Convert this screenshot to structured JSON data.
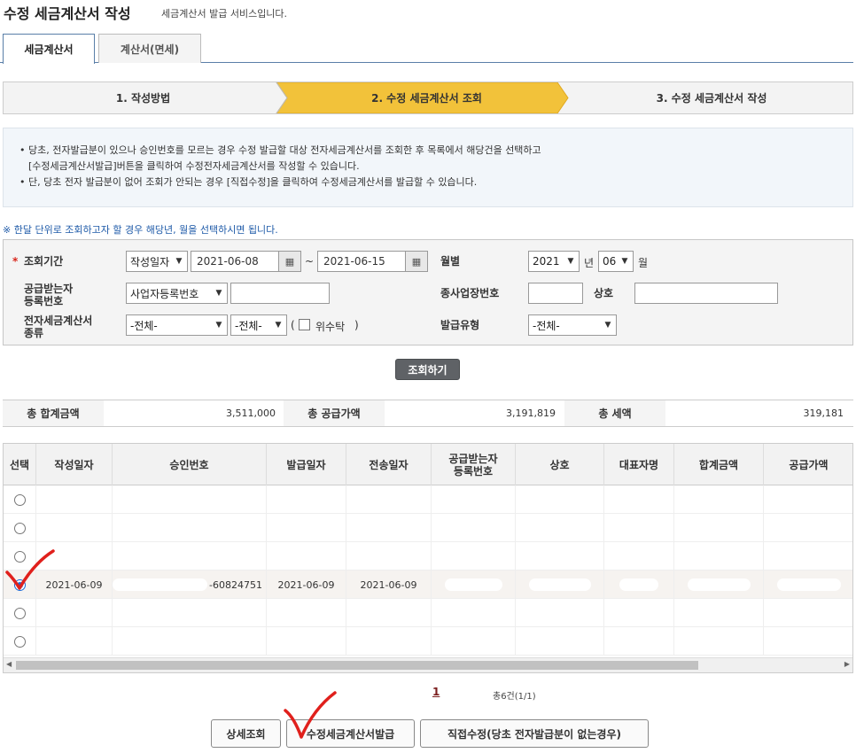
{
  "page": {
    "title": "수정 세금계산서 작성",
    "subtitle": "세금계산서 발급 서비스입니다."
  },
  "tabs": [
    {
      "label": "세금계산서",
      "active": true
    },
    {
      "label": "계산서(면세)",
      "active": false
    }
  ],
  "steps": [
    {
      "label": "1. 작성방법",
      "active": false
    },
    {
      "label": "2. 수정 세금계산서 조회",
      "active": true
    },
    {
      "label": "3. 수정 세금계산서 작성",
      "active": false
    }
  ],
  "notice": [
    "• 당초, 전자발급분이 있으나 승인번호를 모르는 경우 수정 발급할 대상 전자세금계산서를 조회한 후 목록에서 해당건을 선택하고",
    "  [수정세금계산서발급]버튼을 클릭하여 수정전자세금계산서를 작성할 수 있습니다.",
    "• 단, 당초 전자 발급분이 없어 조회가 안되는 경우 [직접수정]을 클릭하여 수정세금계산서를 발급할 수 있습니다."
  ],
  "hint": "※ 한달 단위로 조회하고자 할 경우 해당년, 월을 선택하시면 됩니다.",
  "search": {
    "period_required": "*",
    "period_label": "조회기간",
    "period_type": "작성일자",
    "date_from": "2021-06-08",
    "tilde": "~",
    "date_to": "2021-06-15",
    "monthly_label": "월별",
    "year": "2021",
    "year_unit": "년",
    "month": "06",
    "month_unit": "월",
    "recipient_label_1": "공급받는자",
    "recipient_label_2": "등록번호",
    "recipient_type": "사업자등록번호",
    "recipient_value": "",
    "branch_label": "종사업장번호",
    "branch_value": "",
    "company_label": "상호",
    "company_value": "",
    "kind_label_1": "전자세금계산서",
    "kind_label_2": "종류",
    "kind_1": "-전체-",
    "kind_2": "-전체-",
    "paren_open": "(",
    "trust_label": "위수탁",
    "paren_close": ")",
    "issue_type_label": "발급유형",
    "issue_type": "-전체-",
    "search_button": "조회하기"
  },
  "summary": {
    "total_label": "총 합계금액",
    "total_value": "3,511,000",
    "supply_label": "총 공급가액",
    "supply_value": "3,191,819",
    "tax_label": "총 세액",
    "tax_value": "319,181"
  },
  "table": {
    "headers": [
      "선택",
      "작성일자",
      "승인번호",
      "발급일자",
      "전송일자",
      "공급받는자\n등록번호",
      "상호",
      "대표자명",
      "합계금액",
      "공급가액"
    ],
    "header_recipient_1": "공급받는자",
    "header_recipient_2": "등록번호",
    "rows": [
      {
        "selected": false,
        "date": "",
        "approval": "",
        "issue": "",
        "send": ""
      },
      {
        "selected": false,
        "date": "",
        "approval": "",
        "issue": "",
        "send": ""
      },
      {
        "selected": false,
        "date": "",
        "approval": "",
        "issue": "",
        "send": ""
      },
      {
        "selected": true,
        "date": "2021-06-09",
        "approval": "-60824751",
        "issue": "2021-06-09",
        "send": "2021-06-09"
      },
      {
        "selected": false,
        "date": "",
        "approval": "",
        "issue": "",
        "send": ""
      },
      {
        "selected": false,
        "date": "",
        "approval": "",
        "issue": "",
        "send": ""
      }
    ]
  },
  "pagination": {
    "current": "1",
    "count_text": "총6건(1/1)"
  },
  "buttons": {
    "detail": "상세조회",
    "modify_issue": "수정세금계산서발급",
    "direct_modify": "직접수정(당초 전자발급분이 없는경우)"
  },
  "colors": {
    "step_active": "#f2c23a",
    "accent_blue": "#1e5aa8",
    "annotation_red": "#e0201c"
  }
}
